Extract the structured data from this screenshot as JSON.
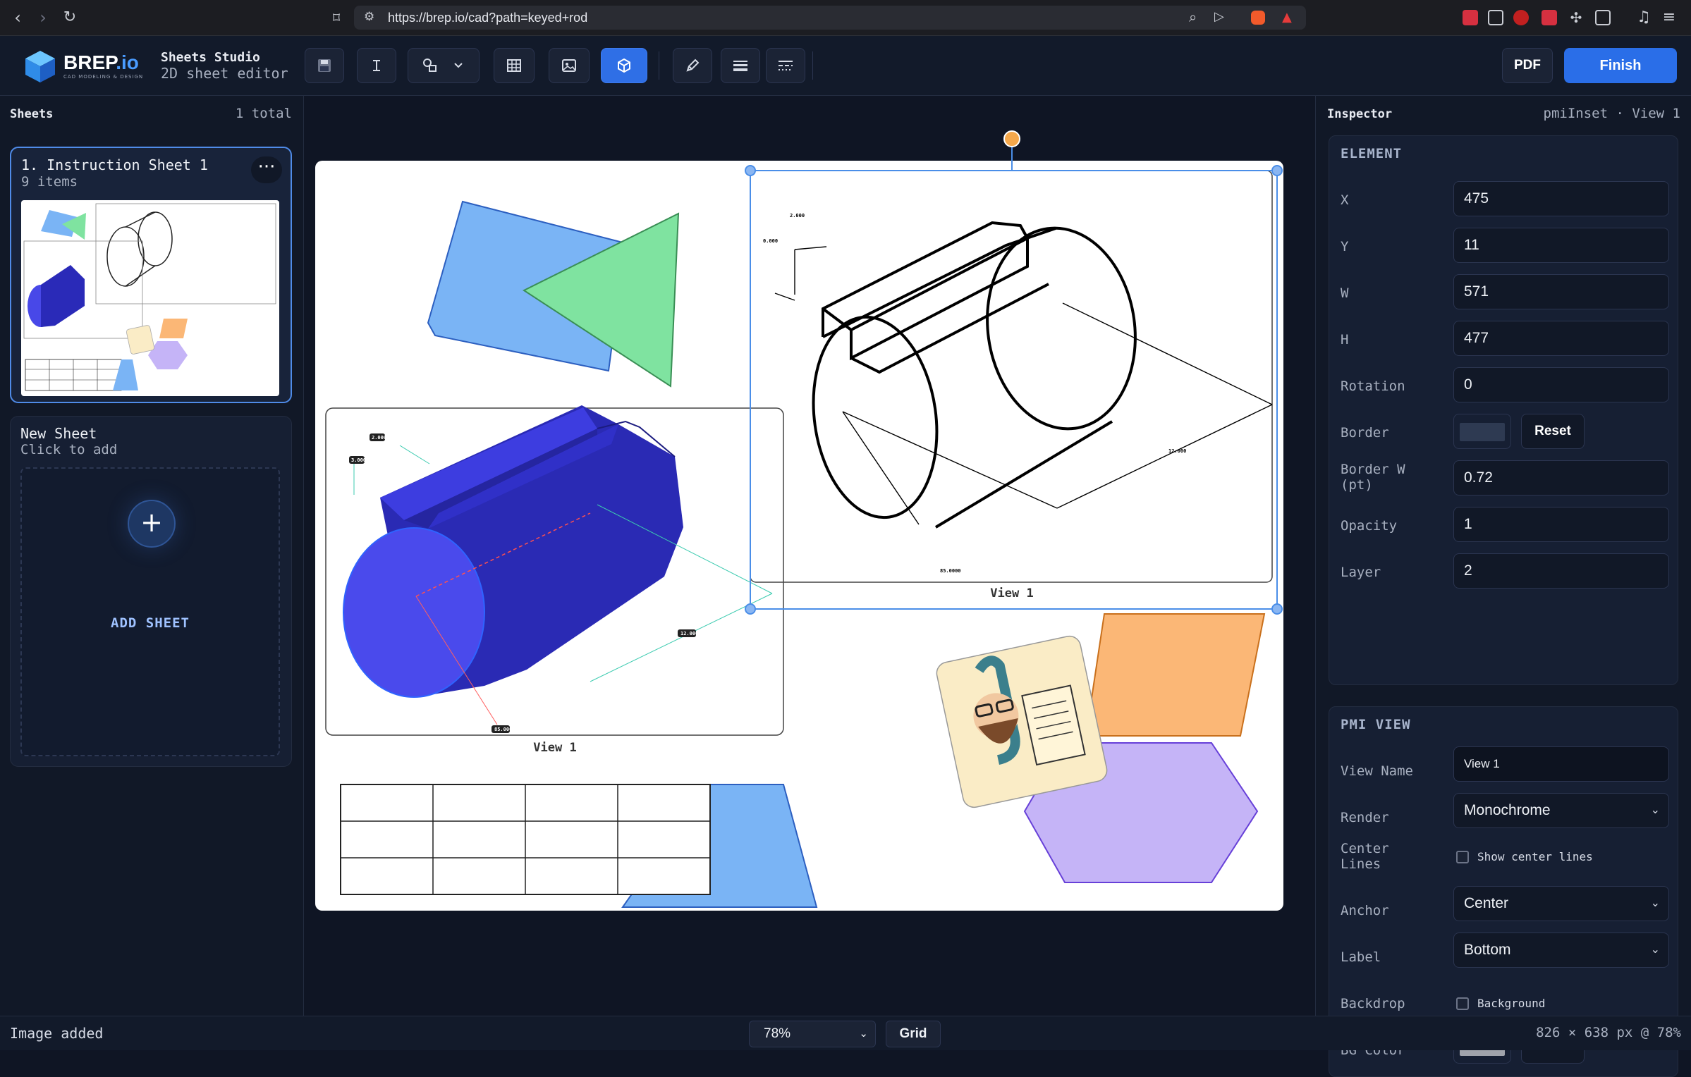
{
  "browser": {
    "url": "https://brep.io/cad?path=keyed+rod"
  },
  "header": {
    "logo_text": "BREP",
    "logo_suffix": ".io",
    "logo_tagline": "CAD MODELING & DESIGN",
    "studio_title": "Sheets Studio",
    "studio_subtitle": "2D sheet editor",
    "pdf_label": "PDF",
    "finish_label": "Finish",
    "accent_color": "#2a6ee8"
  },
  "sheets_panel": {
    "title": "Sheets",
    "total": "1 total",
    "sheets": [
      {
        "title": "1. Instruction Sheet 1",
        "items": "9 items",
        "menu": "···"
      }
    ],
    "new_sheet": {
      "title": "New Sheet",
      "subtitle": "Click to add",
      "plus": "+",
      "button": "ADD SHEET"
    }
  },
  "canvas": {
    "view_labels": [
      "View 1",
      "View 1"
    ],
    "dimension_labels": [
      "2.000",
      "0.000",
      "12.000",
      "85.0000",
      "2.000",
      "3.000",
      "12.000",
      "85.000"
    ]
  },
  "inspector": {
    "title": "Inspector",
    "context": "pmiInset · View 1",
    "element_group": {
      "title": "ELEMENT",
      "x_label": "X",
      "x": "475",
      "y_label": "Y",
      "y": "11",
      "w_label": "W",
      "w": "571",
      "h_label": "H",
      "h": "477",
      "rotation_label": "Rotation",
      "rotation": "0",
      "border_label": "Border",
      "border_color": "#2e3a52",
      "border_reset": "Reset",
      "border_w_label": "Border W\n(pt)",
      "border_w": "0.72",
      "opacity_label": "Opacity",
      "opacity": "1",
      "layer_label": "Layer",
      "layer": "2"
    },
    "pmi_group": {
      "title": "PMI VIEW",
      "view_name_label": "View Name",
      "view_name": "View 1",
      "render_label": "Render",
      "render": "Monochrome",
      "center_lines_label": "Center\nLines",
      "center_lines_text": "Show center lines",
      "anchor_label": "Anchor",
      "anchor": "Center",
      "label_label": "Label",
      "label": "Bottom",
      "backdrop_label": "Backdrop",
      "backdrop_text": "Background",
      "bg_color_label": "BG Color",
      "bg_color": "#a0a3ab",
      "bg_reset": "Reset"
    }
  },
  "status": {
    "message": "Image added",
    "zoom": "78%",
    "grid": "Grid",
    "dimensions": "826 × 638 px @ 78%"
  }
}
